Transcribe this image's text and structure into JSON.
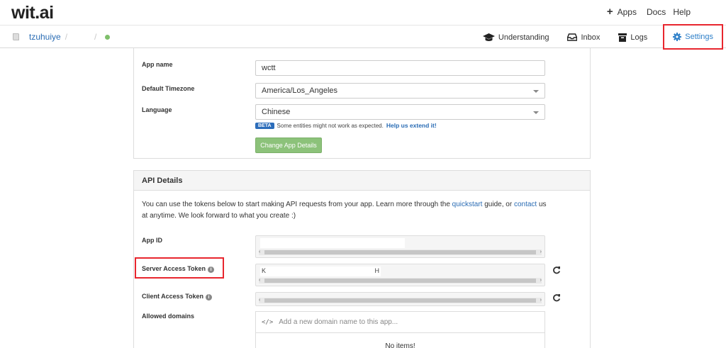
{
  "brand": {
    "logo": "wit.ai"
  },
  "topnav": {
    "apps": "Apps",
    "docs": "Docs",
    "help": "Help"
  },
  "breadcrumb": {
    "user": "tzuhuiye",
    "sep1": "/",
    "sep2": "/"
  },
  "tabs": [
    {
      "label": "Understanding",
      "icon": "graduation-cap-icon"
    },
    {
      "label": "Inbox",
      "icon": "inbox-icon"
    },
    {
      "label": "Logs",
      "icon": "archive-icon"
    },
    {
      "label": "Settings",
      "icon": "gear-icon",
      "active": true
    }
  ],
  "app_details": {
    "app_name_label": "App name",
    "app_name_value": "wctt",
    "timezone_label": "Default Timezone",
    "timezone_value": "America/Los_Angeles",
    "language_label": "Language",
    "language_value": "Chinese",
    "beta_badge": "BETA",
    "beta_note": "Some entities might not work as expected.",
    "beta_link": "Help us extend it!",
    "change_button": "Change App Details"
  },
  "api_details": {
    "heading": "API Details",
    "desc_part1": "You can use the tokens below to start making API requests from your app. Learn more through the ",
    "desc_link1": "quickstart",
    "desc_part2": " guide, or ",
    "desc_link2": "contact",
    "desc_part3": " us at anytime. We look forward to what you create :)",
    "app_id_label": "App ID",
    "server_token_label": "Server Access Token",
    "server_token_start": "K",
    "server_token_end": "H",
    "client_token_label": "Client Access Token",
    "allowed_domains_label": "Allowed domains",
    "domain_placeholder": "Add a new domain name to this app...",
    "domain_code_icon": "</>",
    "no_items": "No items!"
  },
  "colors": {
    "accent": "#2f80c9",
    "highlight": "#e8262e",
    "button_green": "#8cc27a",
    "status_dot": "#7fbf6b"
  }
}
